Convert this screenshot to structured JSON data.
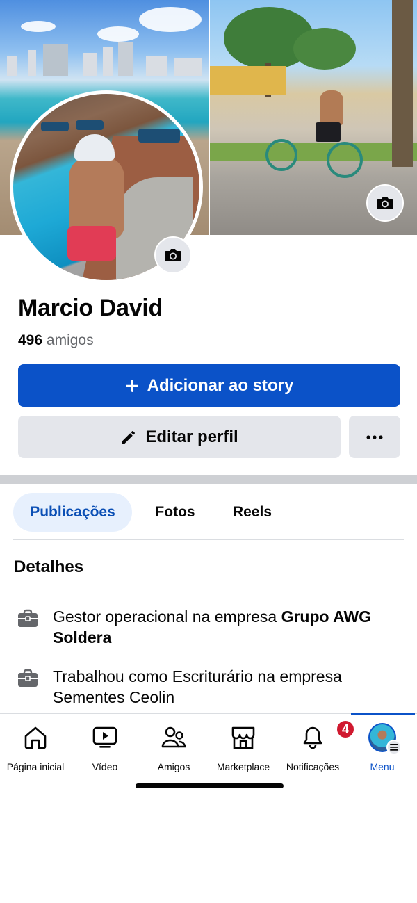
{
  "profile": {
    "name": "Marcio David",
    "friends_count": "496",
    "friends_label": "amigos"
  },
  "cover": {
    "camera_icon": "camera-icon"
  },
  "avatar": {
    "camera_icon": "camera-icon"
  },
  "actions": {
    "story_label": "Adicionar ao story",
    "edit_label": "Editar perfil",
    "more_icon": "more-horizontal-icon"
  },
  "tabs": [
    {
      "label": "Publicações",
      "active": true
    },
    {
      "label": "Fotos",
      "active": false
    },
    {
      "label": "Reels",
      "active": false
    }
  ],
  "details": {
    "title": "Detalhes",
    "items": [
      {
        "icon": "briefcase-icon",
        "text": "Gestor operacional na empresa ",
        "bold": "Grupo AWG Soldera"
      },
      {
        "icon": "briefcase-icon",
        "text": "Trabalhou como Escriturário na empresa Sementes Ceolin",
        "bold": ""
      }
    ]
  },
  "nav": {
    "items": [
      {
        "label": "Página inicial",
        "icon": "home-icon"
      },
      {
        "label": "Vídeo",
        "icon": "video-icon"
      },
      {
        "label": "Amigos",
        "icon": "friends-icon"
      },
      {
        "label": "Marketplace",
        "icon": "marketplace-icon"
      },
      {
        "label": "Notificações",
        "icon": "bell-icon",
        "badge": "4"
      },
      {
        "label": "Menu",
        "icon": "menu-avatar-icon",
        "active": true
      }
    ]
  },
  "colors": {
    "primary": "#0b52c8",
    "secondary_button": "#e4e6eb",
    "active_tab_bg": "#e7f0fd",
    "badge": "#d0192f"
  }
}
